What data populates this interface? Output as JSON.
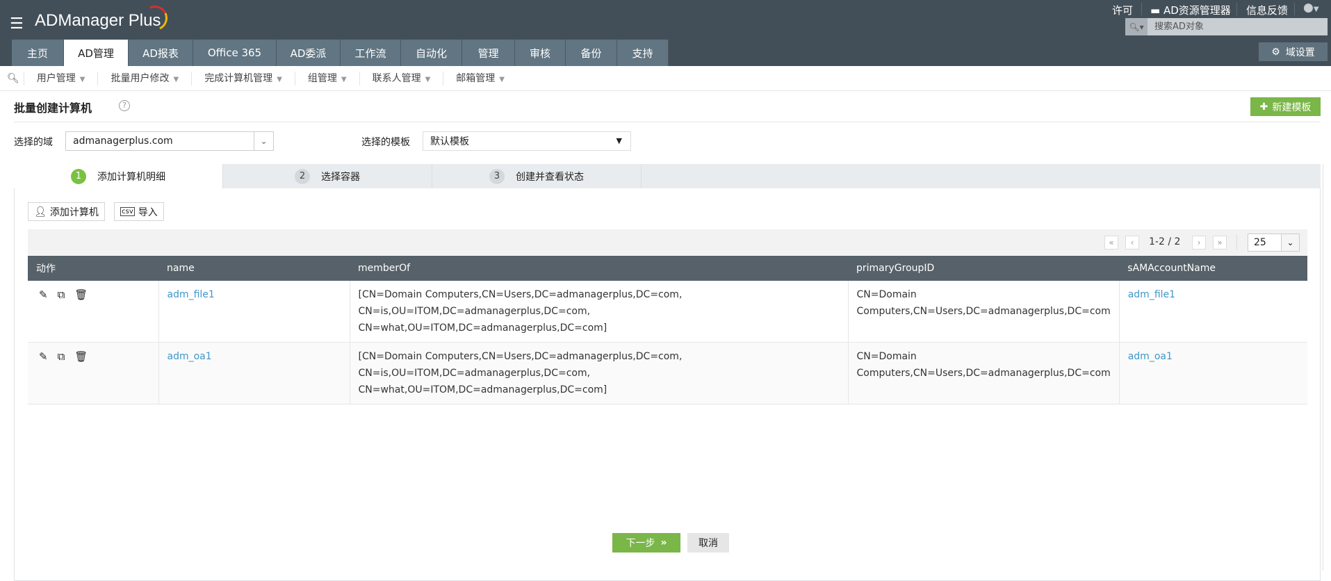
{
  "header": {
    "logo": "ADManager Plus",
    "top_links": [
      "许可",
      "AD资源管理器",
      "信息反馈"
    ],
    "search_placeholder": "搜索AD对象",
    "domain_settings": "域设置"
  },
  "tabs": [
    "主页",
    "AD管理",
    "AD报表",
    "Office 365",
    "AD委派",
    "工作流",
    "自动化",
    "管理",
    "审核",
    "备份",
    "支持"
  ],
  "active_tab": "AD管理",
  "subnav": [
    "用户管理",
    "批量用户修改",
    "完成计算机管理",
    "组管理",
    "联系人管理",
    "邮箱管理"
  ],
  "page": {
    "title": "批量创建计算机",
    "new_template": "新建模板",
    "domain_label": "选择的域",
    "domain_value": "admanagerplus.com",
    "template_label": "选择的模板",
    "template_value": "默认模板"
  },
  "steps": [
    {
      "num": "1",
      "label": "添加计算机明细"
    },
    {
      "num": "2",
      "label": "选择容器"
    },
    {
      "num": "3",
      "label": "创建并查看状态"
    }
  ],
  "toolbar": {
    "add_computer": "添加计算机",
    "import": "导入"
  },
  "pager": {
    "range": "1-2 / 2",
    "page_size": "25"
  },
  "table": {
    "headers": [
      "动作",
      "name",
      "memberOf",
      "primaryGroupID",
      "sAMAccountName"
    ],
    "rows": [
      {
        "name": "adm_file1",
        "memberOf": "[CN=Domain Computers,CN=Users,DC=admanagerplus,DC=com, CN=is,OU=ITOM,DC=admanagerplus,DC=com, CN=what,OU=ITOM,DC=admanagerplus,DC=com]",
        "primaryGroupID": "CN=Domain Computers,CN=Users,DC=admanagerplus,DC=com",
        "sAMAccountName": "adm_file1"
      },
      {
        "name": "adm_oa1",
        "memberOf": "[CN=Domain Computers,CN=Users,DC=admanagerplus,DC=com, CN=is,OU=ITOM,DC=admanagerplus,DC=com, CN=what,OU=ITOM,DC=admanagerplus,DC=com]",
        "primaryGroupID": "CN=Domain Computers,CN=Users,DC=admanagerplus,DC=com",
        "sAMAccountName": "adm_oa1"
      }
    ]
  },
  "footer": {
    "next": "下一步",
    "cancel": "取消"
  },
  "colors": {
    "header": "#434f58",
    "tab": "#617582",
    "accent": "#7ab648",
    "link": "#3f97c9"
  }
}
